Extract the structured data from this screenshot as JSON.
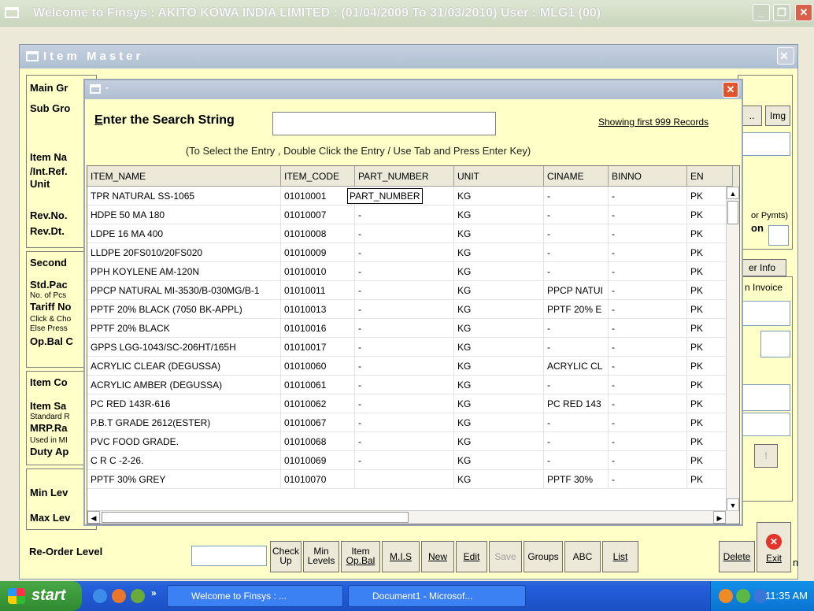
{
  "window": {
    "title": "Welcome to Finsys : AKITO KOWA INDIA LIMITED : (01/04/2009 To 31/03/2010) User : MLG1 (00)"
  },
  "item_master": {
    "title": "Item Master",
    "labels": {
      "main_group": "Main Gr",
      "sub_group": "Sub Gro",
      "item_name": "Item Na",
      "int_ref": "/Int.Ref.",
      "unit": "Unit",
      "rev_no": "Rev.No.",
      "rev_dt": "Rev.Dt.",
      "secondary": "Second",
      "std_pack": "Std.Pac",
      "no_of_pcs": "No. of Pcs",
      "tariff_no": "Tariff No",
      "click_ch": "Click & Cho",
      "else_press": "Else Press",
      "op_bal": "Op.Bal C",
      "item_cost": "Item Co",
      "item_sale": "Item Sa",
      "standard": "Standard R",
      "mrp_rate": "MRP.Ra",
      "used_in": "Used in MI",
      "duty_ap": "Duty Ap",
      "min_level": "Min Lev",
      "max_level": "Max Lev",
      "reorder_level": "Re-Order Level",
      "or_pymts": "or Pymts)",
      "on": "on",
      "er_info": "er Info",
      "n_invoice": "n Invoice",
      "n": "n",
      "img": "Img",
      "dots": "..",
      "bang": "!"
    },
    "buttons": {
      "check_up_1": "Check",
      "check_up_2": "Up",
      "min_levels_1": "Min",
      "min_levels_2": "Levels",
      "item_opbal_1": "Item",
      "item_opbal_2": "Op.Bal",
      "mis": "M.I.S",
      "new": "New",
      "edit": "Edit",
      "save": "Save",
      "groups": "Groups",
      "abc": "ABC",
      "list": "List",
      "delete": "Delete",
      "exit": "Exit"
    }
  },
  "search": {
    "title": "-",
    "prompt": "Enter the Search String",
    "showing": "Showing first 999 Records",
    "hint": "(To Select the Entry , Double Click the Entry / Use Tab and Press Enter Key)",
    "search_value": "",
    "columns": [
      "ITEM_NAME",
      "ITEM_CODE",
      "PART_NUMBER",
      "UNIT",
      "CINAME",
      "BINNO",
      "EN"
    ],
    "editing_cell": "PART_NUMBER",
    "rows": [
      [
        "TPR NATURAL SS-1065",
        "01010001",
        "",
        "KG",
        "-",
        "-",
        "PK"
      ],
      [
        "HDPE 50 MA 180",
        "01010007",
        "-",
        "KG",
        "-",
        "-",
        "PK"
      ],
      [
        "LDPE 16 MA 400",
        "01010008",
        "-",
        "KG",
        "-",
        "-",
        "PK"
      ],
      [
        "LLDPE 20FS010/20FS020",
        "01010009",
        "-",
        "KG",
        "-",
        "-",
        "PK"
      ],
      [
        "PPH KOYLENE AM-120N",
        "01010010",
        "-",
        "KG",
        "-",
        "-",
        "PK"
      ],
      [
        "PPCP NATURAL MI-3530/B-030MG/B-1",
        "01010011",
        "-",
        "KG",
        "PPCP NATUI",
        "-",
        "PK"
      ],
      [
        "PPTF 20% BLACK (7050 BK-APPL)",
        "01010013",
        "-",
        "KG",
        "PPTF 20% E",
        "-",
        "PK"
      ],
      [
        "PPTF 20% BLACK",
        "01010016",
        "-",
        "KG",
        "-",
        "-",
        "PK"
      ],
      [
        "GPPS LGG-1043/SC-206HT/165H",
        "01010017",
        "-",
        "KG",
        "-",
        "-",
        "PK"
      ],
      [
        "ACRYLIC CLEAR (DEGUSSA)",
        "01010060",
        "-",
        "KG",
        "ACRYLIC CL",
        "-",
        "PK"
      ],
      [
        "ACRYLIC AMBER (DEGUSSA)",
        "01010061",
        "-",
        "KG",
        "-",
        "-",
        "PK"
      ],
      [
        "PC RED 143R-616",
        "01010062",
        "-",
        "KG",
        "PC RED 143",
        "-",
        "PK"
      ],
      [
        "P.B.T GRADE 2612(ESTER)",
        "01010067",
        "-",
        "KG",
        "-",
        "-",
        "PK"
      ],
      [
        "PVC FOOD GRADE.",
        "01010068",
        "-",
        "KG",
        "-",
        "-",
        "PK"
      ],
      [
        "C R C -2-26.",
        "01010069",
        "-",
        "KG",
        "-",
        "-",
        "PK"
      ],
      [
        "PPTF 30% GREY",
        "01010070",
        "",
        "KG",
        "PPTF 30%",
        "-",
        "PK"
      ]
    ]
  },
  "taskbar": {
    "start": "start",
    "tasks": [
      "Welcome to Finsys : ...",
      "Document1 - Microsof..."
    ],
    "more": "»",
    "clock": "11:35 AM"
  },
  "colors": {
    "form_bg": "#ffffc8",
    "title_blue": "#aebfd2",
    "close_red": "#e0532b",
    "taskbar_blue": "#245edb"
  }
}
